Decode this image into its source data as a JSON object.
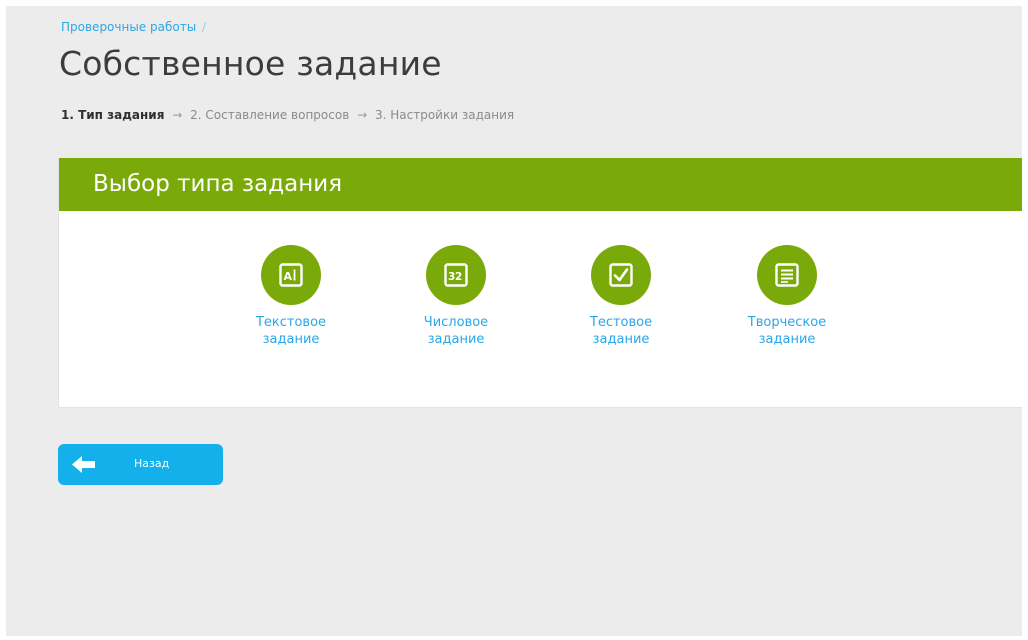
{
  "breadcrumb": {
    "parent": "Проверочные работы",
    "separator": "/"
  },
  "page": {
    "title": "Собственное задание"
  },
  "steps": [
    {
      "label": "1. Тип задания",
      "active": true
    },
    {
      "label": "2. Составление вопросов",
      "active": false
    },
    {
      "label": "3. Настройки задания",
      "active": false
    }
  ],
  "steps_arrow": "→",
  "panel": {
    "title": "Выбор типа задания",
    "types": [
      {
        "line1": "Текстовое",
        "line2": "задание",
        "icon": "text-task-icon"
      },
      {
        "line1": "Числовое",
        "line2": "задание",
        "icon": "number-task-icon"
      },
      {
        "line1": "Тестовое",
        "line2": "задание",
        "icon": "test-task-icon"
      },
      {
        "line1": "Творческое",
        "line2": "задание",
        "icon": "creative-task-icon"
      }
    ]
  },
  "back_button": {
    "label": "Назад",
    "icon": "arrow-left-icon"
  },
  "colors": {
    "accent_green": "#7aaa0a",
    "link_blue": "#2aa7e6",
    "button_blue": "#14b0ec",
    "background": "#ececec"
  }
}
